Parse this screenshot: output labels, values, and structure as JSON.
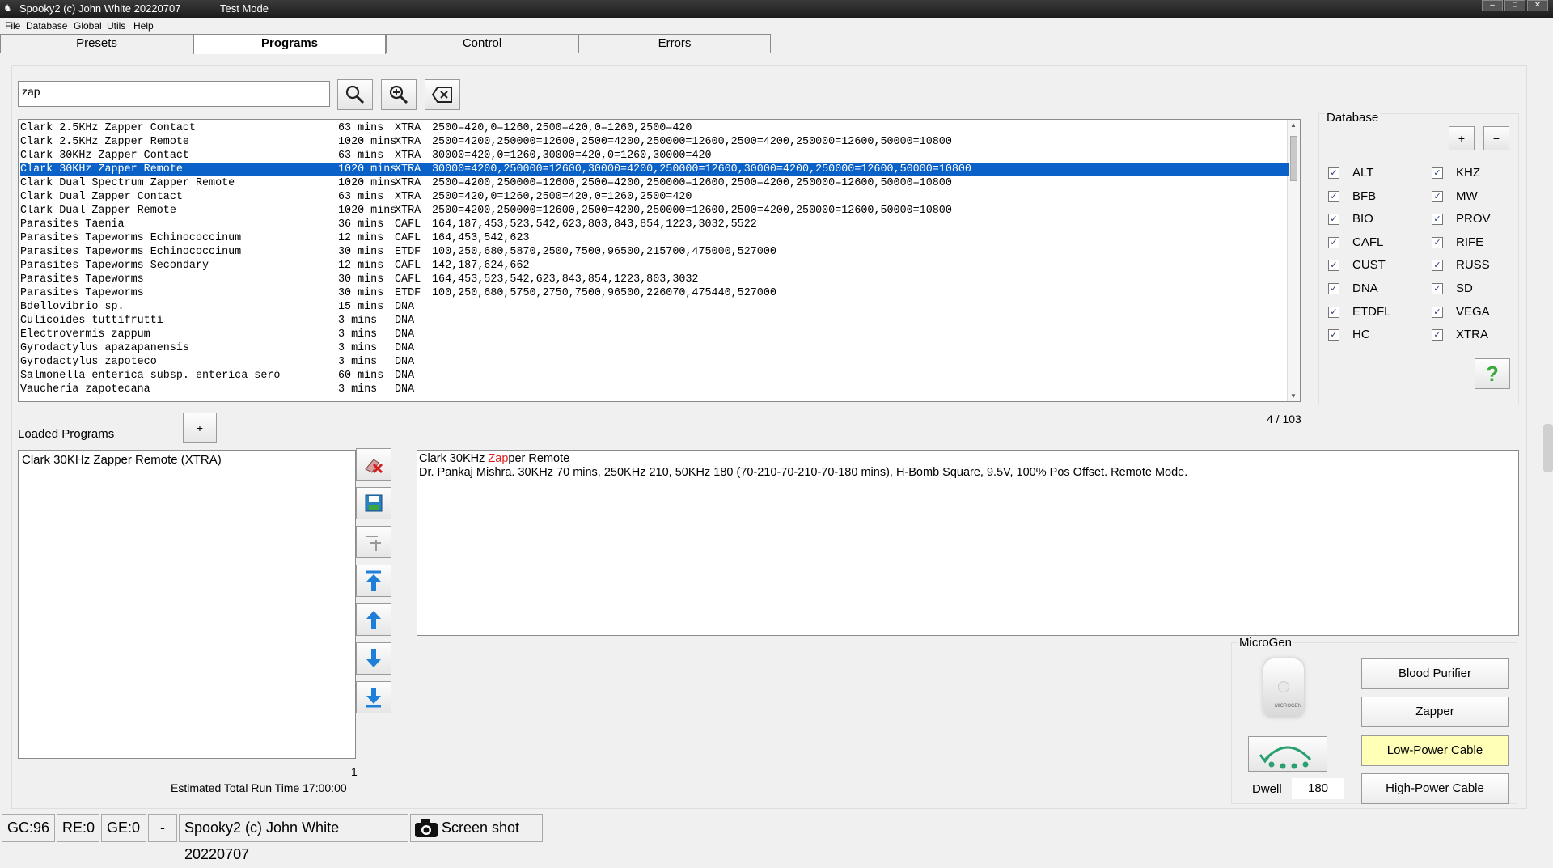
{
  "window": {
    "title": "Spooky2 (c) John White 20220707",
    "mode": "Test Mode"
  },
  "menu": [
    "File",
    "Database",
    "Global",
    "Utils",
    "Help"
  ],
  "tabs": [
    "Presets",
    "Programs",
    "Control",
    "Errors"
  ],
  "search": {
    "value": "zap"
  },
  "programs": [
    {
      "name": "Clark 2.5KHz Zapper Contact",
      "time": "63 mins",
      "db": "XTRA",
      "freqs": "2500=420,0=1260,2500=420,0=1260,2500=420"
    },
    {
      "name": "Clark 2.5KHz Zapper Remote",
      "time": "1020 mins",
      "db": "XTRA",
      "freqs": "2500=4200,250000=12600,2500=4200,250000=12600,2500=4200,250000=12600,50000=10800"
    },
    {
      "name": "Clark 30KHz Zapper Contact",
      "time": "63 mins",
      "db": "XTRA",
      "freqs": "30000=420,0=1260,30000=420,0=1260,30000=420"
    },
    {
      "name": "Clark 30KHz Zapper Remote",
      "time": "1020 mins",
      "db": "XTRA",
      "freqs": "30000=4200,250000=12600,30000=4200,250000=12600,30000=4200,250000=12600,50000=10800",
      "selected": true
    },
    {
      "name": "Clark Dual Spectrum Zapper Remote",
      "time": "1020 mins",
      "db": "XTRA",
      "freqs": "2500=4200,250000=12600,2500=4200,250000=12600,2500=4200,250000=12600,50000=10800"
    },
    {
      "name": "Clark Dual Zapper Contact",
      "time": "63 mins",
      "db": "XTRA",
      "freqs": "2500=420,0=1260,2500=420,0=1260,2500=420"
    },
    {
      "name": "Clark Dual Zapper Remote",
      "time": "1020 mins",
      "db": "XTRA",
      "freqs": "2500=4200,250000=12600,2500=4200,250000=12600,2500=4200,250000=12600,50000=10800"
    },
    {
      "name": "Parasites Taenia",
      "time": "36 mins",
      "db": "CAFL",
      "freqs": "164,187,453,523,542,623,803,843,854,1223,3032,5522"
    },
    {
      "name": "Parasites Tapeworms Echinococcinum",
      "time": "12 mins",
      "db": "CAFL",
      "freqs": "164,453,542,623"
    },
    {
      "name": "Parasites Tapeworms Echinococcinum",
      "time": "30 mins",
      "db": "ETDF",
      "freqs": "100,250,680,5870,2500,7500,96500,215700,475000,527000"
    },
    {
      "name": "Parasites Tapeworms Secondary",
      "time": "12 mins",
      "db": "CAFL",
      "freqs": "142,187,624,662"
    },
    {
      "name": "Parasites Tapeworms",
      "time": "30 mins",
      "db": "CAFL",
      "freqs": "164,453,523,542,623,843,854,1223,803,3032"
    },
    {
      "name": "Parasites Tapeworms",
      "time": "30 mins",
      "db": "ETDF",
      "freqs": "100,250,680,5750,2750,7500,96500,226070,475440,527000"
    },
    {
      "name": "Bdellovibrio sp.",
      "time": "15 mins",
      "db": "DNA",
      "freqs": ""
    },
    {
      "name": "Culicoides tuttifrutti",
      "time": "3 mins",
      "db": "DNA",
      "freqs": ""
    },
    {
      "name": "Electrovermis zappum",
      "time": "3 mins",
      "db": "DNA",
      "freqs": ""
    },
    {
      "name": "Gyrodactylus apazapanensis",
      "time": "3 mins",
      "db": "DNA",
      "freqs": ""
    },
    {
      "name": "Gyrodactylus zapoteco",
      "time": "3 mins",
      "db": "DNA",
      "freqs": ""
    },
    {
      "name": "Salmonella enterica subsp. enterica sero",
      "time": "60 mins",
      "db": "DNA",
      "freqs": ""
    },
    {
      "name": "Vaucheria zapotecana",
      "time": "3 mins",
      "db": "DNA",
      "freqs": ""
    }
  ],
  "database": {
    "title": "Database",
    "add_label": "+",
    "remove_label": "−",
    "left": [
      "ALT",
      "BFB",
      "BIO",
      "CAFL",
      "CUST",
      "DNA",
      "ETDFL",
      "HC"
    ],
    "right": [
      "KHZ",
      "MW",
      "PROV",
      "RIFE",
      "RUSS",
      "SD",
      "VEGA",
      "XTRA"
    ],
    "check": "✓",
    "help": "?"
  },
  "count": "4 / 103",
  "loaded": {
    "title": "Loaded Programs",
    "add_label": "+",
    "items": [
      "Clark 30KHz Zapper Remote (XTRA)"
    ],
    "count": "1",
    "runtime": "Estimated Total Run Time 17:00:00"
  },
  "description": {
    "title_pre": "Clark 30KHz ",
    "title_hl": "Zap",
    "title_post": "per Remote",
    "body": "Dr. Pankaj Mishra. 30KHz 70 mins, 250KHz 210, 50KHz 180 (70-210-70-210-70-180 mins), H-Bomb Square, 9.5V, 100% Pos Offset. Remote Mode."
  },
  "microgen": {
    "title": "MicroGen",
    "device_label": "MICROGEN",
    "buttons": [
      "Blood Purifier",
      "Zapper",
      "Low-Power Cable",
      "High-Power Cable"
    ],
    "dwell_label": "Dwell",
    "dwell_value": "180"
  },
  "status": {
    "gc": "GC:96",
    "re": "RE:0",
    "ge": "GE:0",
    "dash": "-",
    "title": "Spooky2 (c) John White 20220707",
    "screenshot": "Screen shot"
  },
  "colors": {
    "selection": "#0a62c8",
    "highlight_text": "#e02020",
    "low_power_bg": "#ffffb8",
    "arrow_blue": "#1e7fd8"
  }
}
